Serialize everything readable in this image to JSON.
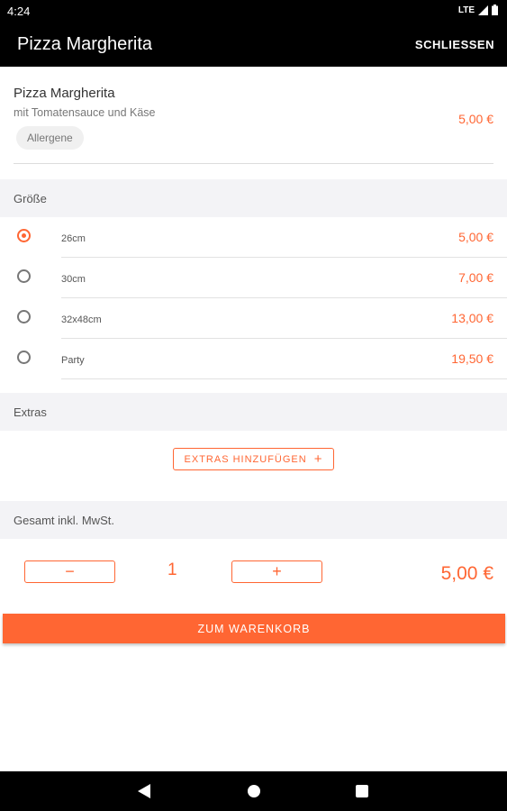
{
  "status_bar": {
    "time": "4:24",
    "network": "LTE"
  },
  "app_bar": {
    "title": "Pizza Margherita",
    "close_label": "SCHLIESSEN"
  },
  "product": {
    "name": "Pizza Margherita",
    "description": "mit Tomatensauce und Käse",
    "allergene_label": "Allergene",
    "price": "5,00 €"
  },
  "size_section": {
    "title": "Größe",
    "options": [
      {
        "label": "26cm",
        "price": "5,00 €",
        "selected": true
      },
      {
        "label": "30cm",
        "price": "7,00 €",
        "selected": false
      },
      {
        "label": "32x48cm",
        "price": "13,00 €",
        "selected": false
      },
      {
        "label": "Party",
        "price": "19,50 €",
        "selected": false
      }
    ]
  },
  "extras_section": {
    "title": "Extras",
    "add_label": "EXTRAS HINZUFÜGEN",
    "add_icon": "+"
  },
  "total_section": {
    "title": "Gesamt inkl. MwSt.",
    "minus_icon": "−",
    "plus_icon": "+",
    "quantity": "1",
    "total": "5,00 €"
  },
  "cart_button": {
    "label": "ZUM WARENKORB"
  },
  "colors": {
    "accent": "#ff6633",
    "section_bg": "#f3f3f6",
    "bar_bg": "#000000"
  }
}
